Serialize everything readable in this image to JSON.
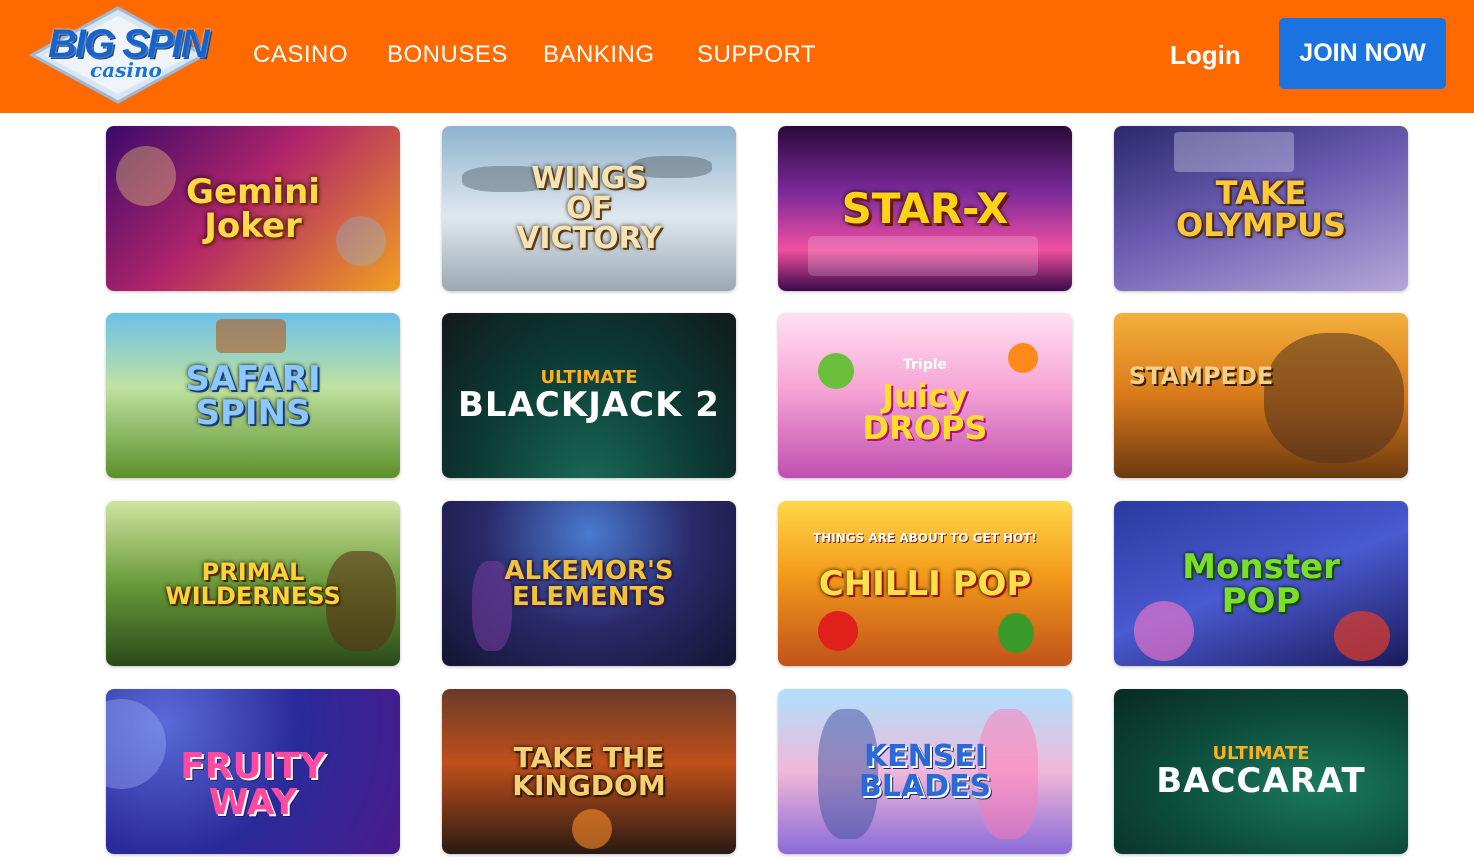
{
  "header": {
    "logo": {
      "line1": "BIG SPIN",
      "line2": "casino"
    },
    "nav": [
      {
        "label": "CASINO"
      },
      {
        "label": "BONUSES"
      },
      {
        "label": "BANKING"
      },
      {
        "label": "SUPPORT"
      }
    ],
    "login_label": "Login",
    "join_label": "JOIN NOW",
    "colors": {
      "header_bg": "#ff6a00",
      "join_bg": "#1a73e0"
    }
  },
  "games": [
    {
      "title": "Gemini\nJoker",
      "sub": ""
    },
    {
      "title": "WINGS\nOF\nVICTORY",
      "sub": ""
    },
    {
      "title": "STAR-X",
      "sub": ""
    },
    {
      "title": "TAKE\nOLYMPUS",
      "sub": ""
    },
    {
      "title": "SAFARI\nSPINS",
      "sub": ""
    },
    {
      "title": "BLACKJACK 2",
      "sub": "ULTIMATE"
    },
    {
      "title": "Juicy\nDROPS",
      "sub": "Triple"
    },
    {
      "title": "STAMPEDE",
      "sub": ""
    },
    {
      "title": "PRIMAL\nWILDERNESS",
      "sub": ""
    },
    {
      "title": "ALKEMOR'S\nELEMENTS",
      "sub": ""
    },
    {
      "title": "CHILLI POP",
      "sub": "THINGS ARE ABOUT TO GET HOT!"
    },
    {
      "title": "Monster\nPOP",
      "sub": ""
    },
    {
      "title": "FRUITY\nWAY",
      "sub": ""
    },
    {
      "title": "TAKE THE\nKINGDOM",
      "sub": ""
    },
    {
      "title": "KENSEI\nBLADES",
      "sub": ""
    },
    {
      "title": "BACCARAT",
      "sub": "ULTIMATE"
    }
  ]
}
